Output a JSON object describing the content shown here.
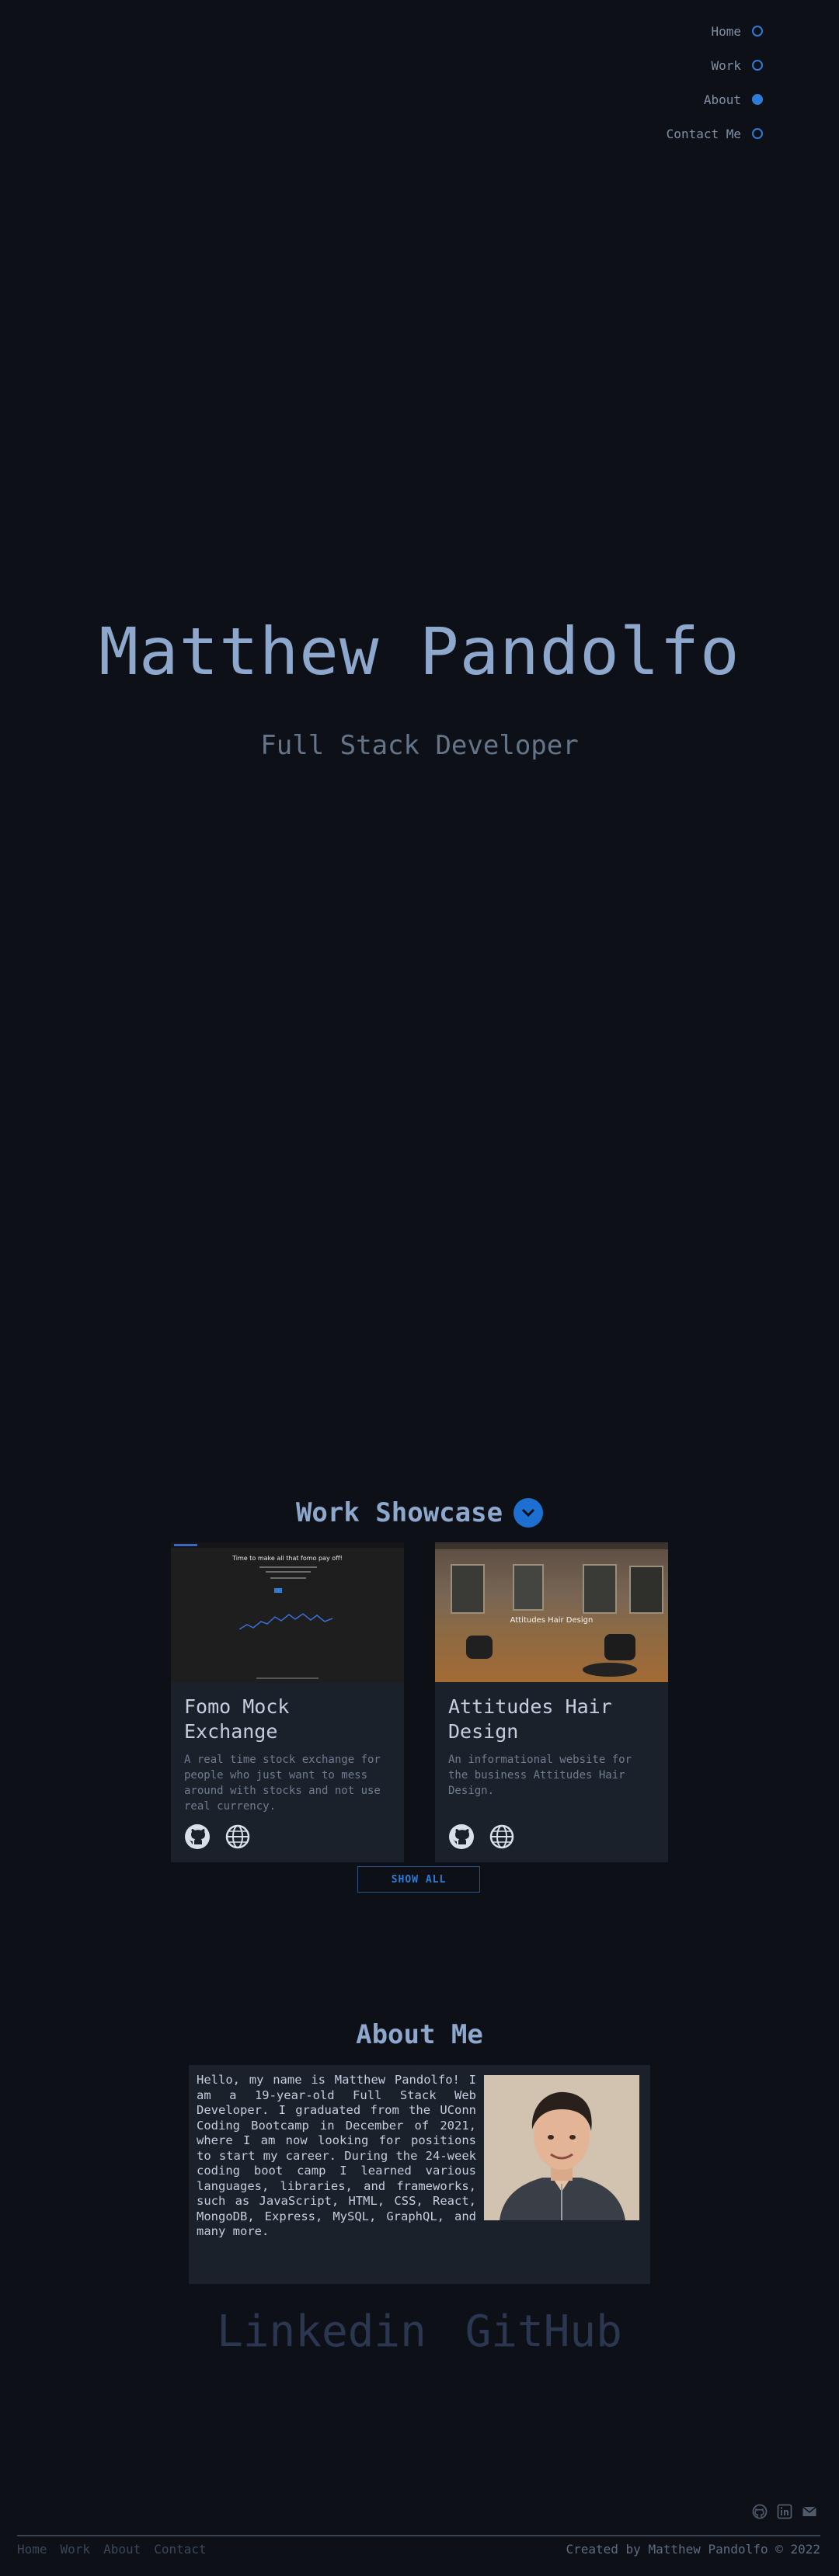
{
  "nav": {
    "items": [
      {
        "label": "Home",
        "active": false
      },
      {
        "label": "Work",
        "active": false
      },
      {
        "label": "About",
        "active": true
      },
      {
        "label": "Contact Me",
        "active": false
      }
    ]
  },
  "hero": {
    "name": "Matthew Pandolfo",
    "subtitle": "Full Stack Developer"
  },
  "work": {
    "title": "Work Showcase",
    "toggle_icon": "chevron-down-icon",
    "projects": [
      {
        "title": "Fomo Mock Exchange",
        "description": "A real time stock exchange for people who just want to mess around with stocks and not use real currency.",
        "thumb_caption": "Time to make all that fomo pay off!",
        "icons": [
          "github-icon",
          "globe-icon"
        ]
      },
      {
        "title": "Attitudes Hair Design",
        "description": "An informational website for the business Attitudes Hair Design.",
        "thumb_caption": "Attitudes Hair Design",
        "icons": [
          "github-icon",
          "globe-icon"
        ]
      }
    ],
    "show_all_label": "SHOW ALL"
  },
  "about": {
    "title": "About Me",
    "text": "Hello, my name is Matthew Pandolfo! I am a 19-year-old Full Stack Web Developer. I graduated from the UConn Coding Bootcamp in December of 2021, where I am now looking for positions to start my career. During the 24-week coding boot camp I learned various languages, libraries, and frameworks, such as JavaScript, HTML, CSS, React, MongoDB, Express, MySQL, GraphQL, and many more.",
    "links": {
      "linkedin": "Linkedin",
      "github": "GitHub"
    }
  },
  "footer": {
    "nav": [
      "Home",
      "Work",
      "About",
      "Contact"
    ],
    "credit": "Created by Matthew Pandolfo © 2022",
    "icons": [
      "github-icon",
      "linkedin-icon",
      "mail-icon"
    ]
  },
  "colors": {
    "background": "#0d1117",
    "accent": "#2f7bd8",
    "heading": "#8ea7cc",
    "card": "#1b212b"
  }
}
